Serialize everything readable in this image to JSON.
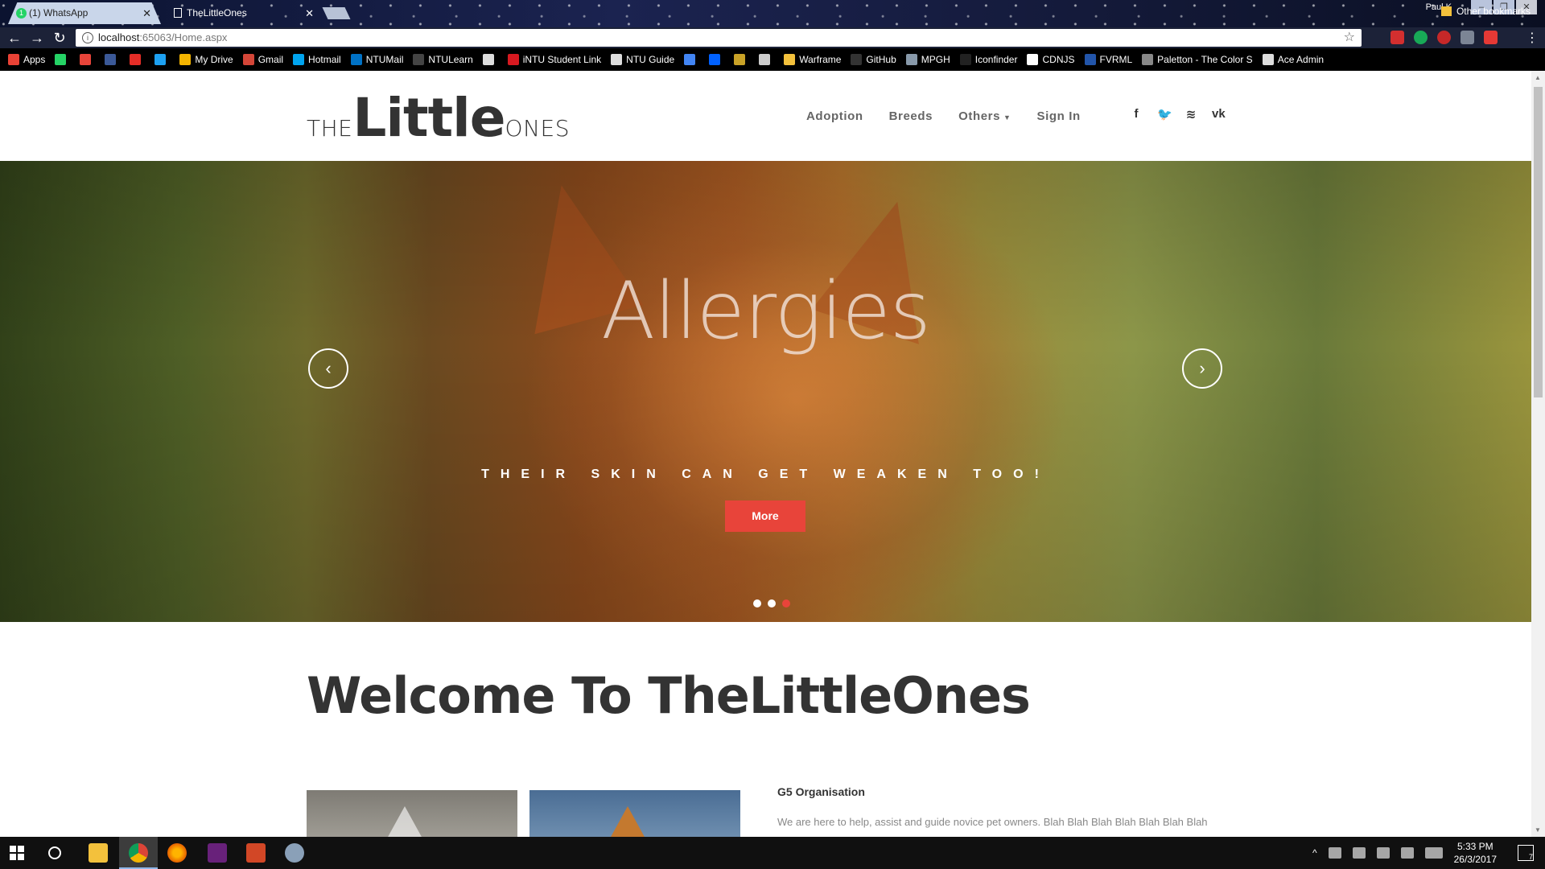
{
  "browser": {
    "tabs": [
      {
        "label": "(1) WhatsApp",
        "badge": "1"
      },
      {
        "label": "TheLittleOnes"
      }
    ],
    "profile": "Paul K",
    "url_host": "localhost",
    "url_rest": ":65063/Home.aspx",
    "bookmarks": [
      {
        "label": "Apps",
        "icon": "apps-grid-icon",
        "color": "#e94235"
      },
      {
        "label": "",
        "icon": "whatsapp-icon",
        "color": "#25d366"
      },
      {
        "label": "",
        "icon": "x-icon",
        "color": "#e8443a"
      },
      {
        "label": "",
        "icon": "facebook-icon",
        "color": "#3b5998"
      },
      {
        "label": "",
        "icon": "youtube-icon",
        "color": "#e52d27"
      },
      {
        "label": "",
        "icon": "twitter-icon",
        "color": "#1da1f2"
      },
      {
        "label": "My Drive",
        "icon": "drive-icon",
        "color": "#f4b400"
      },
      {
        "label": "Gmail",
        "icon": "gmail-icon",
        "color": "#d44638"
      },
      {
        "label": "Hotmail",
        "icon": "windows-icon",
        "color": "#00a4ef"
      },
      {
        "label": "NTUMail",
        "icon": "outlook-icon",
        "color": "#0072c6"
      },
      {
        "label": "NTULearn",
        "icon": "bb-icon",
        "color": "#444444"
      },
      {
        "label": "",
        "icon": "page-icon",
        "color": "#dddddd"
      },
      {
        "label": "iNTU Student Link",
        "icon": "ntu-icon",
        "color": "#d71920"
      },
      {
        "label": "NTU Guide",
        "icon": "page-icon",
        "color": "#dddddd"
      },
      {
        "label": "",
        "icon": "google-icon",
        "color": "#4285f4"
      },
      {
        "label": "",
        "icon": "dropbox-icon",
        "color": "#0061ff"
      },
      {
        "label": "",
        "icon": "shield-icon",
        "color": "#c9a227"
      },
      {
        "label": "",
        "icon": "monitor-icon",
        "color": "#cccccc"
      },
      {
        "label": "Warframe",
        "icon": "folder-icon",
        "color": "#f3c13c"
      },
      {
        "label": "GitHub",
        "icon": "github-icon",
        "color": "#333333"
      },
      {
        "label": "MPGH",
        "icon": "mpgh-icon",
        "color": "#8899aa"
      },
      {
        "label": "Iconfinder",
        "icon": "iconfinder-icon",
        "color": "#222222"
      },
      {
        "label": "CDNJS",
        "icon": "cdnjs-icon",
        "color": "#ffffff"
      },
      {
        "label": "FVRML",
        "icon": "fvrml-icon",
        "color": "#2255aa"
      },
      {
        "label": "Paletton - The Color S",
        "icon": "paletton-icon",
        "color": "#888888"
      },
      {
        "label": "Ace Admin",
        "icon": "page-icon",
        "color": "#dddddd"
      }
    ],
    "other_bookmarks": "Other bookmarks"
  },
  "site": {
    "logo": {
      "prefix": "THE",
      "main": "Little",
      "suffix": "ONES"
    },
    "nav": [
      {
        "label": "Adoption"
      },
      {
        "label": "Breeds"
      },
      {
        "label": "Others",
        "has_dropdown": true
      },
      {
        "label": "Sign In"
      }
    ],
    "social": [
      {
        "icon": "facebook-icon",
        "glyph": "f"
      },
      {
        "icon": "twitter-icon",
        "glyph": "t"
      },
      {
        "icon": "rss-icon",
        "glyph": "))"
      },
      {
        "icon": "vk-icon",
        "glyph": "vk"
      }
    ]
  },
  "hero": {
    "title": "Allergies",
    "subtitle": "THEIR SKIN CAN GET WEAKEN TOO!",
    "button": "More",
    "prev": "‹",
    "next": "›",
    "slides": 3,
    "active_slide": 3,
    "accent": "#e8443a"
  },
  "welcome": {
    "title": "Welcome To TheLittleOnes",
    "org_title": "G5 Organisation",
    "org_text": "We are here to help, assist and guide novice pet owners. Blah Blah Blah Blah Blah Blah Blah"
  },
  "taskbar": {
    "time": "5:33 PM",
    "date": "26/3/2017",
    "notifications": "7"
  }
}
